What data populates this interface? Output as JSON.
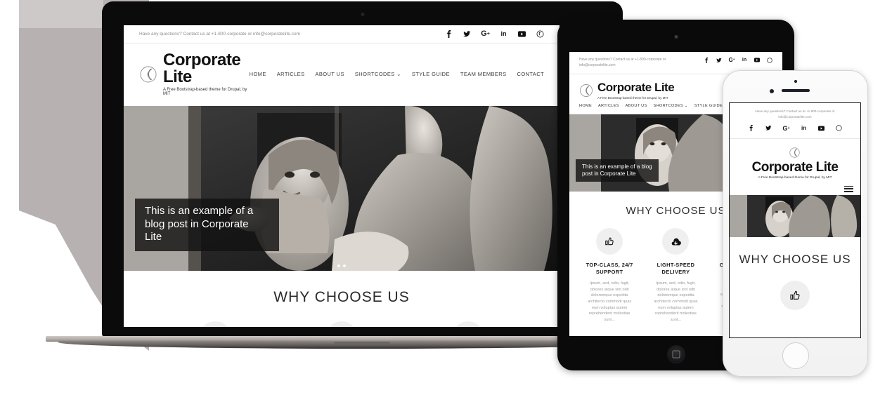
{
  "site": {
    "topbar": {
      "contact_text": "Have any questions? Contact us at +1-800-corporate or info@corporatelite.com",
      "contact_text_line1": "Have any questions? Contact us at +1-800-corporate or",
      "contact_text_line2": "info@corporatelite.com",
      "social": [
        {
          "name": "facebook-icon",
          "glyph": "f"
        },
        {
          "name": "twitter-icon",
          "glyph": "🐦"
        },
        {
          "name": "google-plus-icon",
          "glyph": "G+"
        },
        {
          "name": "linkedin-icon",
          "glyph": "in"
        },
        {
          "name": "youtube-icon",
          "glyph": "▶"
        },
        {
          "name": "pinterest-icon",
          "glyph": "Ⓟ"
        }
      ]
    },
    "brand": {
      "title": "Corporate Lite",
      "tagline": "A Free Bootstrap-based theme for Drupal, by MIT",
      "logo_name": "corporate-lite-logo"
    },
    "nav": [
      {
        "label": "HOME"
      },
      {
        "label": "ARTICLES"
      },
      {
        "label": "ABOUT US"
      },
      {
        "label": "SHORTCODES ⌄"
      },
      {
        "label": "STYLE GUIDE"
      },
      {
        "label": "TEAM MEMBERS"
      },
      {
        "label": "CONTACT"
      }
    ],
    "hero": {
      "caption": "This is an example of a blog post in Corporate Lite",
      "slides": 2,
      "active_slide": 2
    },
    "why": {
      "heading": "WHY CHOOSE US",
      "features": [
        {
          "icon": "thumbs-up-icon",
          "title": "TOP-CLASS, 24/7 SUPPORT",
          "text": "Ipsum, sed, odio, fugit, dolores atque sint odit doloremque expedita architecto commodi quas eum voluptas autem reprehenderit molestiae sunt..."
        },
        {
          "icon": "cloud-download-icon",
          "title": "LIGHT-SPEED DELIVERY",
          "text": "Ipsum, sed, odio, fugit, dolores atque sint odit doloremque expedita architecto commodi quas eum voluptas autem reprehenderit molestiae sunt..."
        },
        {
          "icon": "globe-icon",
          "title": "GLOBAL REACH",
          "text": "Ipsum, sed, odio, fugit, dolores atque sint odit doloremque expedita architecto commodi quas eum voluptas autem reprehenderit molestiae sunt..."
        }
      ]
    },
    "mobile": {
      "menu_icon": "hamburger-menu-icon"
    }
  },
  "colors": {
    "background": "#ffffff",
    "text_dark": "#1c1c1c",
    "text_muted": "#9b9b9b",
    "circle_bg": "#efefef",
    "device_black": "#0a0a0b",
    "device_silver": "#f2f2f2"
  },
  "devices": [
    {
      "name": "laptop"
    },
    {
      "name": "tablet"
    },
    {
      "name": "smartphone"
    }
  ]
}
